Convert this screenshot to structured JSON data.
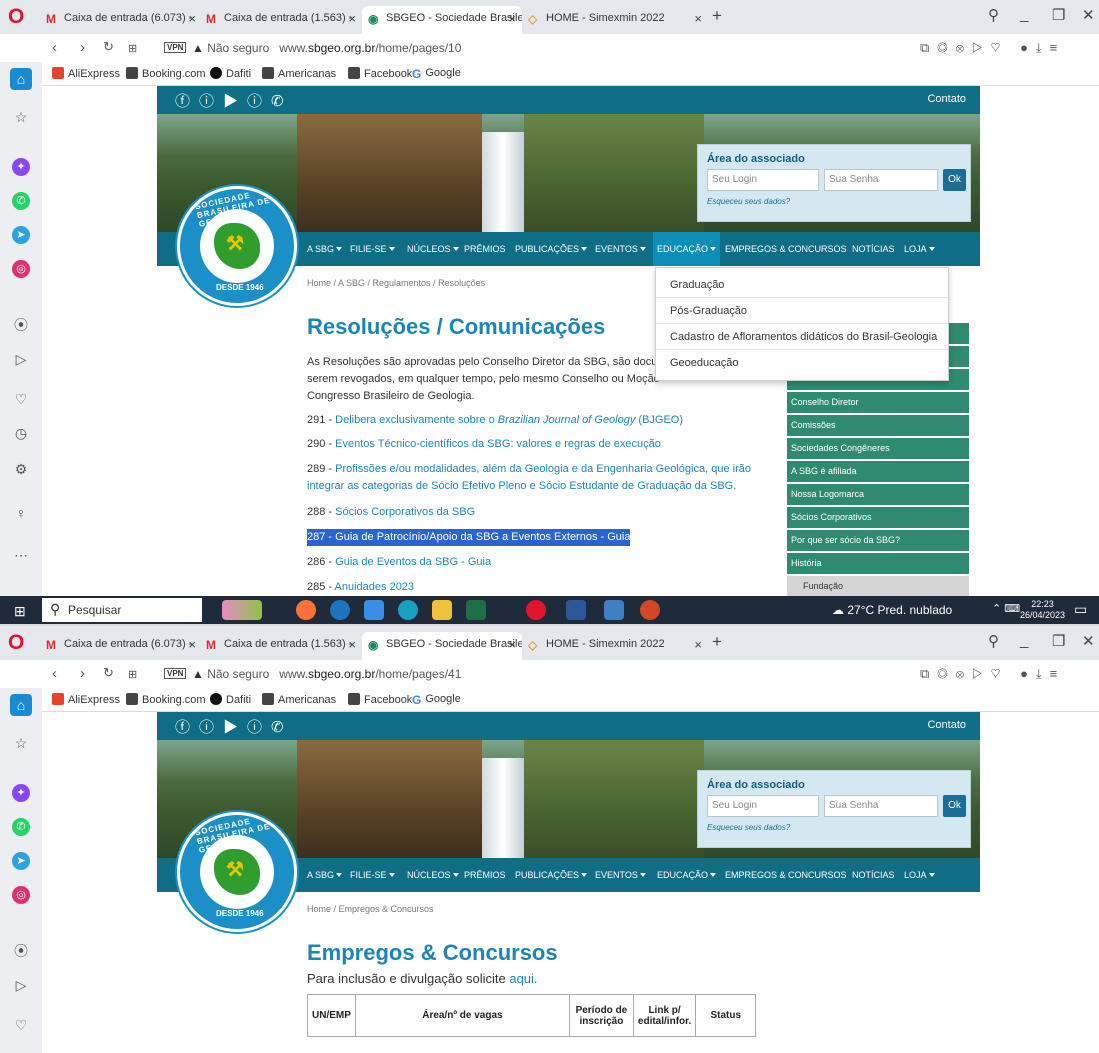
{
  "browser": {
    "tabs": [
      {
        "label": "Caixa de entrada (6.073) - ",
        "icon": "gmail-icon",
        "active": false
      },
      {
        "label": "Caixa de entrada (1.563) - ",
        "icon": "gmail-icon",
        "active": false
      },
      {
        "label": "SBGEO - Sociedade Brasile",
        "icon": "sbgeo-icon",
        "active": true
      },
      {
        "label": "HOME - Simexmin 2022",
        "icon": "diamond-icon",
        "active": false
      }
    ],
    "tab_close": "×",
    "new_tab": "+",
    "vpn_badge": "VPN",
    "not_secure": "Não seguro",
    "bookmarks": [
      "AliExpress",
      "Booking.com",
      "Dafiti",
      "Americanas",
      "Facebook",
      "Google"
    ]
  },
  "shot1": {
    "url_prefix": "www.",
    "url_domain": "sbgeo.org.br",
    "url_path": "/home/pages/10",
    "breadcrumb": "Home  /  A SBG  /  Regulamentos  /  Resoluções",
    "title": "Resoluções / Comunicações",
    "intro_1": "As Resoluções são aprovadas pelo Conselho Diretor da SBG, são docume",
    "intro_2": "serem revogados, em qualquer tempo,  pelo mesmo Conselho ou Moção",
    "intro_3": "Congresso Brasileiro de Geologia.",
    "resolutions": [
      {
        "num": "291 - ",
        "text": "Delibera exclusivamente sobre o ",
        "italic": "Brazilian Journal of Geology",
        "tail": " (BJGEO)"
      },
      {
        "num": "290 - ",
        "text": "Eventos Técnico-científicos da SBG: valores e regras de execução"
      },
      {
        "num": "289 - ",
        "text": "Profissões e/ou modalidades, além da Geologia e da Engenharia Geológica, que irão"
      },
      {
        "num": "",
        "text": "integrar as categorias de Sócio Efetivo Pleno e Sócio Estudante de Graduação da SBG."
      },
      {
        "num": "288 - ",
        "text": "Sócios Corporativos da SBG"
      },
      {
        "num": "287 - ",
        "text": "Guia de Patrocínio/Apoio da SBG a Eventos Externos - Guia"
      },
      {
        "num": "286 - ",
        "text": "Guia de Eventos da SBG - Guia"
      },
      {
        "num": "285 - ",
        "text": "Anuidades 2023"
      }
    ],
    "educacao_dropdown": [
      "Graduação",
      "Pós-Graduação",
      "Cadastro de Afloramentos didáticos do Brasil-Geologia",
      "Geoeducação"
    ],
    "right_menu": [
      "Conselho Diretor",
      "Comissões",
      "Sociedades Congêneres",
      "A SBG é afiliada",
      "Nossa Logomarca",
      "Sócios Corporativos",
      "Por que ser sócio da SBG?",
      "História"
    ],
    "right_submenu": "Fundação"
  },
  "shot2": {
    "url_prefix": "www.",
    "url_domain": "sbgeo.org.br",
    "url_path": "/home/pages/41",
    "breadcrumb": "Home  /  Empregos & Concursos",
    "title": "Empregos & Concursos",
    "intro": "Para inclusão e divulgação solicite ",
    "intro_link": "aqui.",
    "table_headers": [
      "UN/EMP",
      "Área/nº de vagas",
      "Período de inscrição",
      "Link p/ edital/infor.",
      "Status"
    ]
  },
  "site": {
    "contato": "Contato",
    "login_title": "Área do associado",
    "login_placeholder": "Seu Login",
    "password_placeholder": "Sua Senha",
    "login_button": "Ok",
    "forgot": "Esqueceu seus dados?",
    "logo_arc": "SOCIEDADE BRASILEIRA DE GEOLOGIA",
    "logo_since": "DESDE 1946",
    "menu": [
      "A SBG",
      "FILIE-SE",
      "NÚCLEOS",
      "PRÊMIOS",
      "PUBLICAÇÕES",
      "EVENTOS",
      "EDUCAÇÃO",
      "EMPREGOS & CONCURSOS",
      "NOTÍCIAS",
      "LOJA"
    ],
    "menu_has_caret": [
      true,
      true,
      true,
      false,
      true,
      true,
      true,
      false,
      false,
      true
    ]
  },
  "taskbar": {
    "search": "Pesquisar",
    "weather": "27°C  Pred. nublado",
    "time": "22:23",
    "date": "26/04/2023"
  },
  "colors": {
    "site_teal": "#0f6d86",
    "link_blue": "#1b85b8",
    "menu_green": "#2e8b72",
    "selection": "#2b63d1"
  }
}
